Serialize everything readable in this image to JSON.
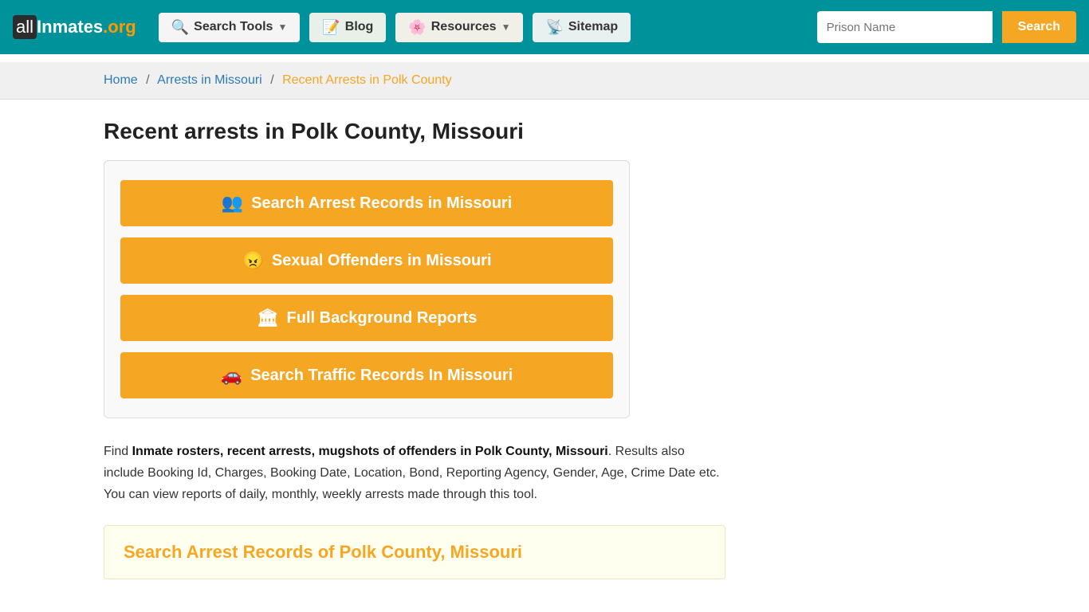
{
  "nav": {
    "logo": {
      "all": "all",
      "inmates": "Inmates",
      "org": ".org"
    },
    "search_tools_label": "Search Tools",
    "blog_label": "Blog",
    "resources_label": "Resources",
    "sitemap_label": "Sitemap",
    "search_placeholder": "Prison Name",
    "search_button_label": "Search"
  },
  "breadcrumb": {
    "home": "Home",
    "sep1": "/",
    "arrests": "Arrests in Missouri",
    "sep2": "/",
    "current": "Recent Arrests in Polk County"
  },
  "page": {
    "title": "Recent arrests in Polk County, Missouri",
    "buttons": [
      {
        "id": "arrest-records",
        "icon": "👥",
        "label": "Search Arrest Records in Missouri"
      },
      {
        "id": "sexual-offenders",
        "icon": "😠",
        "label": "Sexual Offenders in Missouri"
      },
      {
        "id": "background-reports",
        "icon": "🏛",
        "label": "Full Background Reports"
      },
      {
        "id": "traffic-records",
        "icon": "🚗",
        "label": "Search Traffic Records In Missouri"
      }
    ],
    "description_prefix": "Find ",
    "description_bold": "Inmate rosters, recent arrests, mugshots of offenders in Polk County, Missouri",
    "description_suffix": ". Results also include Booking Id, Charges, Booking Date, Location, Bond, Reporting Agency, Gender, Age, Crime Date etc. You can view reports of daily, monthly, weekly arrests made through this tool.",
    "search_section_title": "Search Arrest Records of Polk County, Missouri"
  }
}
